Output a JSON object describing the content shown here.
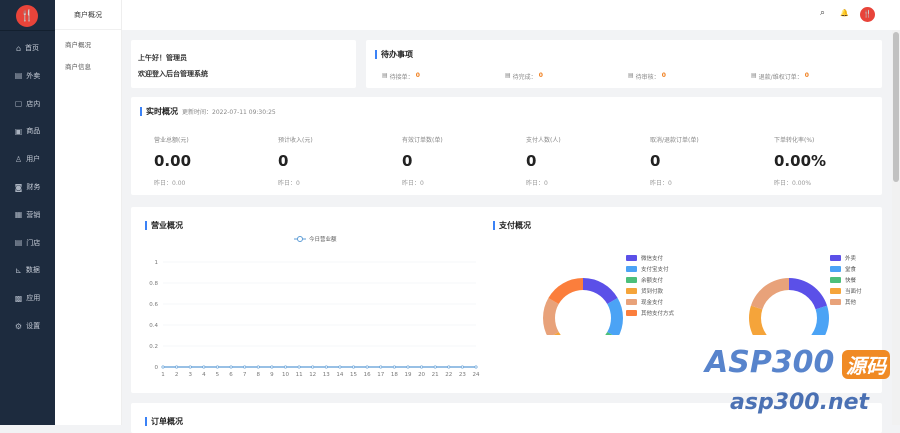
{
  "sidebar": {
    "items": [
      {
        "label": "首页",
        "icon": "⌂"
      },
      {
        "label": "外卖",
        "icon": "▤"
      },
      {
        "label": "店内",
        "icon": "▢"
      },
      {
        "label": "商品",
        "icon": "▣"
      },
      {
        "label": "用户",
        "icon": "♙"
      },
      {
        "label": "财务",
        "icon": "◙"
      },
      {
        "label": "营销",
        "icon": "▦"
      },
      {
        "label": "门店",
        "icon": "▤"
      },
      {
        "label": "数据",
        "icon": "⊾"
      },
      {
        "label": "应用",
        "icon": "▩"
      },
      {
        "label": "设置",
        "icon": "⚙"
      }
    ]
  },
  "submenu": {
    "title": "商户概况",
    "items": [
      "商户概况",
      "商户信息"
    ]
  },
  "greeting": {
    "line1": "上午好！管理员",
    "line2": "欢迎登入后台管理系统"
  },
  "pending": {
    "title": "待办事项",
    "items": [
      {
        "label": "待接单：",
        "value": "0"
      },
      {
        "label": "待完成：",
        "value": "0"
      },
      {
        "label": "待审核：",
        "value": "0"
      },
      {
        "label": "退款/维权订单：",
        "value": "0"
      }
    ]
  },
  "realtime": {
    "title": "实时概况",
    "time": "更新时间：2022-07-11 09:30:25",
    "stats": [
      {
        "label": "营业总额(元)",
        "value": "0.00",
        "yday": "昨日：0.00"
      },
      {
        "label": "预计收入(元)",
        "value": "0",
        "yday": "昨日：0"
      },
      {
        "label": "有效订单数(单)",
        "value": "0",
        "yday": "昨日：0"
      },
      {
        "label": "支付人数(人)",
        "value": "0",
        "yday": "昨日：0"
      },
      {
        "label": "取消/退款订单(单)",
        "value": "0",
        "yday": "昨日：0"
      },
      {
        "label": "下单转化率(%)",
        "value": "0.00%",
        "yday": "昨日：0.00%"
      }
    ]
  },
  "revenue": {
    "title": "营业概况"
  },
  "payment": {
    "title": "支付概况"
  },
  "order": {
    "title": "订单概况"
  },
  "chart_data": [
    {
      "type": "line",
      "title": "营业概况",
      "series": [
        {
          "name": "今日营业额",
          "color": "#5b9bd5",
          "values": [
            0,
            0,
            0,
            0,
            0,
            0,
            0,
            0,
            0,
            0,
            0,
            0,
            0,
            0,
            0,
            0,
            0,
            0,
            0,
            0,
            0,
            0,
            0,
            0
          ]
        }
      ],
      "x": [
        "1",
        "2",
        "3",
        "4",
        "5",
        "6",
        "7",
        "8",
        "9",
        "10",
        "11",
        "12",
        "13",
        "14",
        "15",
        "16",
        "17",
        "18",
        "19",
        "20",
        "21",
        "22",
        "23",
        "24"
      ],
      "yticks": [
        "0",
        "0.2",
        "0.4",
        "0.6",
        "0.8",
        "1"
      ],
      "ylim": [
        0,
        1
      ],
      "legend": "top-center"
    },
    {
      "type": "pie",
      "title": "支付方式",
      "labels": [
        "微信支付",
        "支付宝支付",
        "余额支付",
        "货到付款",
        "现金支付",
        "其他支付方式"
      ],
      "values": [
        1,
        1,
        1,
        1,
        1,
        1
      ],
      "colors": [
        "#5b50e8",
        "#4ba3f5",
        "#4cbf7a",
        "#f5a43a",
        "#e8a27a",
        "#fb7e3c"
      ],
      "legend": "right"
    },
    {
      "type": "pie",
      "title": "订单类型",
      "labels": [
        "外卖",
        "堂食",
        "快餐",
        "当面付",
        "其他"
      ],
      "values": [
        1,
        1,
        1,
        1,
        1
      ],
      "colors": [
        "#5b50e8",
        "#4ba3f5",
        "#4cbf7a",
        "#f5a43a",
        "#e8a27a"
      ],
      "legend": "right"
    }
  ],
  "header": {
    "search_icon": "⌕",
    "bell_icon": "🔔"
  },
  "watermark": {
    "text": "ASP300",
    "badge": "源码",
    "url": "asp300.net"
  }
}
